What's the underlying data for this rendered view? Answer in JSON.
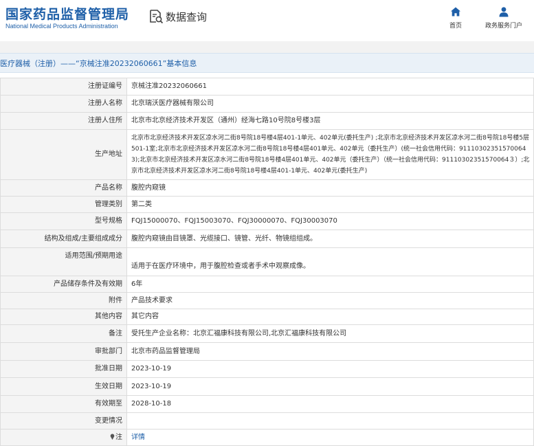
{
  "header": {
    "logo_cn": "国家药品监督管理局",
    "logo_en": "National Medical Products Administration",
    "search_label": "数据查询",
    "search_icon": "search-document-icon",
    "nav": [
      {
        "label": "首页",
        "icon": "home-icon"
      },
      {
        "label": "政务服务门户",
        "icon": "user-icon"
      }
    ]
  },
  "colors": {
    "brand": "#1e5fa8",
    "label_bg": "#f4f4f4",
    "title_bg": "#eaf1f8",
    "border": "#dcdcdc"
  },
  "title": "医疗器械（注册）——“京械注准20232060661”基本信息",
  "rows": [
    {
      "label": "注册证编号",
      "value": "京械注准20232060661"
    },
    {
      "label": "注册人名称",
      "value": "北京瑞沃医疗器械有限公司"
    },
    {
      "label": "注册人住所",
      "value": "北京市北京经济技术开发区（通州）经海七路10号院8号楼3层"
    },
    {
      "label": "生产地址",
      "value": "北京市北京经济技术开发区凉水河二街8号院18号楼4层401-1单元、402单元(委托生产) ;北京市北京经济技术开发区凉水河二街8号院18号楼5层501-1室;北京市北京经济技术开发区凉水河二街8号院18号楼4层401单元、402单元（委托生产）(统一社会信用代码：911103023515700643);北京市北京经济技术开发区凉水河二街8号院18号楼4层401单元、402单元（委托生产）（统一社会信用代码：91110302351570064３）;北京市北京经济技术开发区凉水河二街8号院18号楼4层401-1单元、402单元(委托生产)"
    },
    {
      "label": "产品名称",
      "value": "腹腔内窥镜"
    },
    {
      "label": "管理类别",
      "value": "第二类"
    },
    {
      "label": "型号规格",
      "value": "FQJ15000070、FQJ15003070、FQJ30000070、FQJ30003070"
    },
    {
      "label": "结构及组成/主要组成成分",
      "value": "腹腔内窥镜由目镜罩、光缆接口、镜管、光纤、物镜组组成。"
    },
    {
      "label": "适用范围/预期用途",
      "value": "适用于在医疗环境中，用于腹腔检查或者手术中观察成像。"
    },
    {
      "label": "产品储存条件及有效期",
      "value": "6年"
    },
    {
      "label": "附件",
      "value": "产品技术要求"
    },
    {
      "label": "其他内容",
      "value": "其它内容"
    },
    {
      "label": "备注",
      "value": "受托生产企业名称：北京汇福康科技有限公司,北京汇福康科技有限公司"
    },
    {
      "label": "审批部门",
      "value": "北京市药品监督管理局"
    },
    {
      "label": "批准日期",
      "value": "2023-10-19"
    },
    {
      "label": "生效日期",
      "value": "2023-10-19"
    },
    {
      "label": "有效期至",
      "value": "2028-10-18"
    },
    {
      "label": "变更情况",
      "value": ""
    }
  ],
  "note": {
    "label": "注",
    "link": "详情",
    "icon": "pin-icon"
  }
}
